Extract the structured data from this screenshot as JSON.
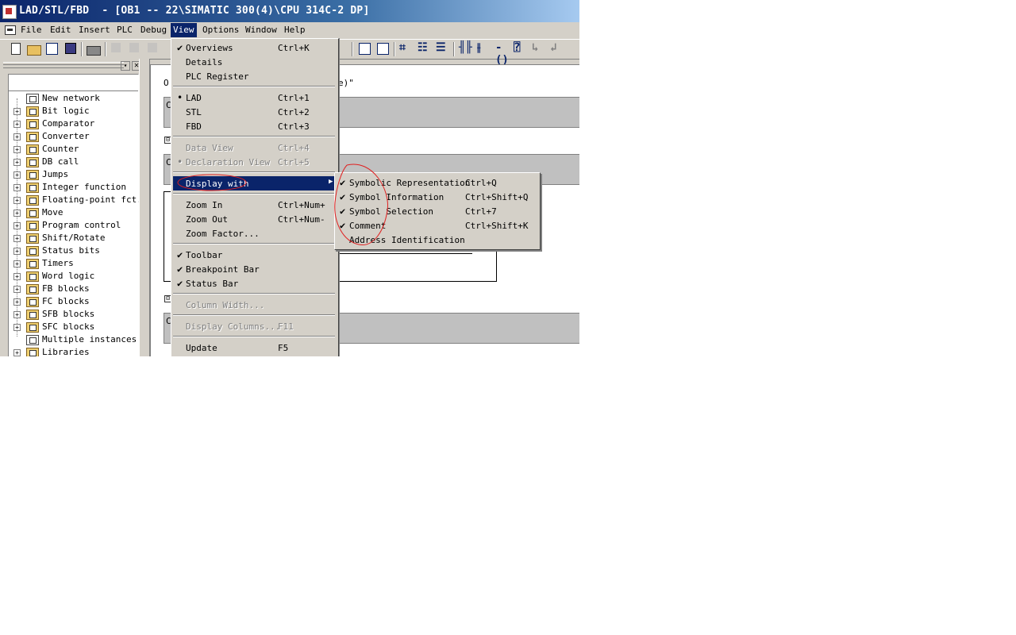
{
  "window": {
    "title": "LAD/STL/FBD  - [OB1 -- 22\\SIMATIC 300(4)\\CPU 314C-2 DP]"
  },
  "menubar": {
    "items": [
      "File",
      "Edit",
      "Insert",
      "PLC",
      "Debug",
      "View",
      "Options",
      "Window",
      "Help"
    ],
    "active": "View"
  },
  "toolbar": {
    "icons": [
      "new-icon",
      "open-icon",
      "accessible-nodes-icon",
      "save-icon",
      "print-icon",
      "cut-icon",
      "copy-icon",
      "paste-icon",
      "overview-icon",
      "zoom-icon",
      "new-network-icon",
      "bit-logic-icon",
      "branch-icon",
      "normally-open-contact-icon",
      "normally-closed-contact-icon",
      "coil-icon",
      "empty-box-icon",
      "open-branch-icon",
      "close-branch-icon"
    ]
  },
  "program_elements": {
    "items": [
      {
        "label": "New network",
        "expandable": false,
        "icon": "new-network-icon"
      },
      {
        "label": "Bit logic",
        "expandable": true,
        "icon": "bit-logic-icon"
      },
      {
        "label": "Comparator",
        "expandable": true,
        "icon": "comparator-icon"
      },
      {
        "label": "Converter",
        "expandable": true,
        "icon": "converter-icon"
      },
      {
        "label": "Counter",
        "expandable": true,
        "icon": "counter-icon"
      },
      {
        "label": "DB call",
        "expandable": true,
        "icon": "db-call-icon"
      },
      {
        "label": "Jumps",
        "expandable": true,
        "icon": "jumps-icon"
      },
      {
        "label": "Integer function",
        "expandable": true,
        "icon": "integer-function-icon"
      },
      {
        "label": "Floating-point fct.",
        "expandable": true,
        "icon": "floating-point-icon"
      },
      {
        "label": "Move",
        "expandable": true,
        "icon": "move-icon"
      },
      {
        "label": "Program control",
        "expandable": true,
        "icon": "program-control-icon"
      },
      {
        "label": "Shift/Rotate",
        "expandable": true,
        "icon": "shift-rotate-icon"
      },
      {
        "label": "Status bits",
        "expandable": true,
        "icon": "status-bits-icon"
      },
      {
        "label": "Timers",
        "expandable": true,
        "icon": "timers-icon"
      },
      {
        "label": "Word logic",
        "expandable": true,
        "icon": "word-logic-icon"
      },
      {
        "label": "FB blocks",
        "expandable": true,
        "icon": "fb-blocks-icon"
      },
      {
        "label": "FC blocks",
        "expandable": true,
        "icon": "fc-blocks-icon"
      },
      {
        "label": "SFB blocks",
        "expandable": true,
        "icon": "sfb-blocks-icon"
      },
      {
        "label": "SFC blocks",
        "expandable": true,
        "icon": "sfc-blocks-icon"
      },
      {
        "label": "Multiple instances",
        "expandable": false,
        "icon": "multiple-instances-icon"
      },
      {
        "label": "Libraries",
        "expandable": true,
        "icon": "libraries-icon"
      }
    ]
  },
  "editor": {
    "line1_start": "O",
    "line1_end": "e)\"",
    "gray_row_letter": "C",
    "minus": "⊟"
  },
  "view_menu": {
    "overviews": {
      "label": "Overviews",
      "key": "Ctrl+K",
      "checked": true
    },
    "details": {
      "label": "Details",
      "key": ""
    },
    "plc_register": {
      "label": "PLC Register",
      "key": ""
    },
    "lad": {
      "label": "LAD",
      "key": "Ctrl+1",
      "bullet": true
    },
    "stl": {
      "label": "STL",
      "key": "Ctrl+2"
    },
    "fbd": {
      "label": "FBD",
      "key": "Ctrl+3"
    },
    "data_view": {
      "label": "Data View",
      "key": "Ctrl+4",
      "disabled": true
    },
    "declaration_view": {
      "label": "Declaration View",
      "key": "Ctrl+5",
      "disabled": true
    },
    "display_with": {
      "label": "Display with"
    },
    "zoom_in": {
      "label": "Zoom In",
      "key": "Ctrl+Num+"
    },
    "zoom_out": {
      "label": "Zoom Out",
      "key": "Ctrl+Num-"
    },
    "zoom_factor": {
      "label": "Zoom Factor..."
    },
    "toolbar": {
      "label": "Toolbar",
      "checked": true
    },
    "breakpoint_bar": {
      "label": "Breakpoint Bar",
      "checked": true
    },
    "status_bar": {
      "label": "Status Bar",
      "checked": true
    },
    "column_width": {
      "label": "Column Width...",
      "disabled": true
    },
    "display_columns": {
      "label": "Display Columns...",
      "key": "F11",
      "disabled": true
    },
    "update": {
      "label": "Update",
      "key": "F5"
    }
  },
  "display_with_submenu": {
    "symbolic_representation": {
      "label": "Symbolic Representation",
      "key": "Ctrl+Q",
      "checked": true
    },
    "symbol_information": {
      "label": "Symbol Information",
      "key": "Ctrl+Shift+Q",
      "checked": true
    },
    "symbol_selection": {
      "label": "Symbol Selection",
      "key": "Ctrl+7",
      "checked": true
    },
    "comment": {
      "label": "Comment",
      "key": "Ctrl+Shift+K",
      "checked": true
    },
    "address_identification": {
      "label": "Address Identification",
      "key": "",
      "checked": false
    }
  },
  "glyphs": {
    "check": "✔",
    "bullet": "•",
    "arrow": "▶",
    "plus": "+",
    "close": "✕",
    "dropdown": "▾"
  },
  "colors": {
    "highlight": "#0a246a",
    "annotation": "#e02020",
    "face": "#d4d0c8"
  }
}
